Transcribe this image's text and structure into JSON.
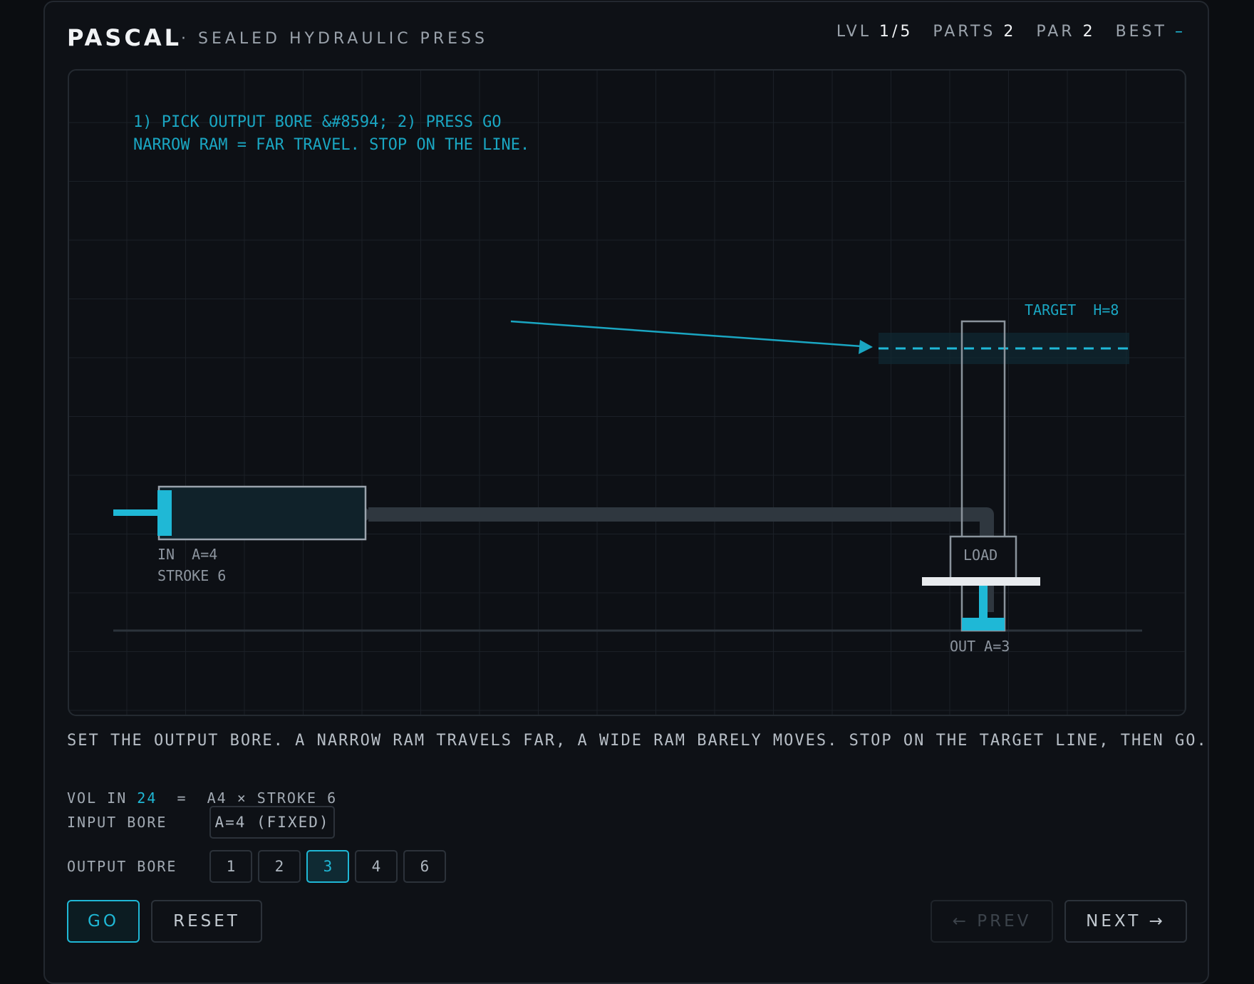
{
  "header": {
    "title": "PASCAL",
    "subtitle": "· SEALED HYDRAULIC PRESS",
    "level_label": "LVL",
    "level_value": "1/5",
    "parts_label": "PARTS",
    "parts_value": "2",
    "par_label": "PAR",
    "par_value": "2",
    "best_label": "BEST",
    "best_value": "–"
  },
  "stage": {
    "hint_line1": "1) PICK OUTPUT BORE  &#8594;  2) PRESS GO",
    "hint_line2": "NARROW RAM = FAR TRAVEL. STOP ON THE LINE.",
    "target_label": "TARGET  H=8",
    "input_label_1": "IN  A=4",
    "input_label_2": "STROKE 6",
    "load_label": "LOAD",
    "output_label": "OUT A=3"
  },
  "description": "SET THE OUTPUT BORE. A NARROW RAM TRAVELS FAR, A WIDE RAM BARELY MOVES. STOP ON THE TARGET LINE, THEN GO.",
  "volume": {
    "prefix": "VOL IN ",
    "value": "24",
    "suffix": "  =  A4 × STROKE 6"
  },
  "input_bore": {
    "label": "INPUT BORE",
    "value": "A=4 (FIXED)"
  },
  "output_bore": {
    "label": "OUTPUT BORE",
    "options": [
      "1",
      "2",
      "3",
      "4",
      "6"
    ],
    "selected": "3"
  },
  "buttons": {
    "go": "GO",
    "reset": "RESET",
    "prev": "← PREV",
    "next": "NEXT →"
  },
  "colors": {
    "accent": "#1fb8d6",
    "background": "#0b0d11",
    "panel": "#0e1116"
  }
}
